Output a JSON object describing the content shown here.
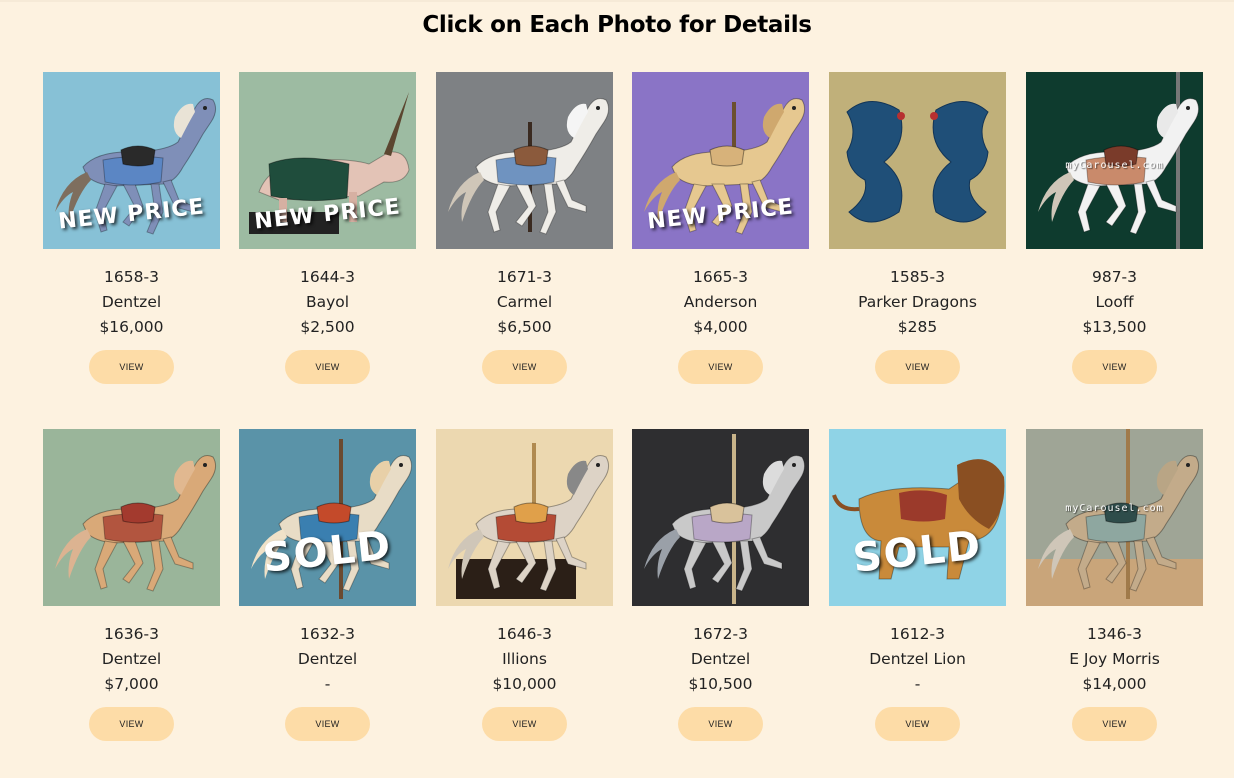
{
  "page": {
    "heading": "Click on Each Photo for Details"
  },
  "colors": {
    "background": "#fdf2e0",
    "button": "#fddca7"
  },
  "watermark_text": "myCarousel.com",
  "rows": [
    [
      {
        "id": "1658-3",
        "maker": "Dentzel",
        "price": "$16,000",
        "badge": "NEW PRICE",
        "button": "VIEW",
        "bg": "#87c1d6",
        "figure": "horse-blue"
      },
      {
        "id": "1644-3",
        "maker": "Bayol",
        "price": "$2,500",
        "badge": "NEW PRICE",
        "button": "VIEW",
        "bg": "#9dbba2",
        "figure": "unicorn"
      },
      {
        "id": "1671-3",
        "maker": "Carmel",
        "price": "$6,500",
        "badge": "",
        "button": "VIEW",
        "bg": "#7e8184",
        "figure": "horse-white"
      },
      {
        "id": "1665-3",
        "maker": "Anderson",
        "price": "$4,000",
        "badge": "NEW PRICE",
        "button": "VIEW",
        "bg": "#8a74c6",
        "figure": "horse-tan"
      },
      {
        "id": "1585-3",
        "maker": "Parker Dragons",
        "price": "$285",
        "badge": "",
        "button": "VIEW",
        "bg": "#c0b07a",
        "figure": "dragons"
      },
      {
        "id": "987-3",
        "maker": "Looff",
        "price": "$13,500",
        "badge": "",
        "button": "VIEW",
        "bg": "#0e3b2e",
        "figure": "horse-white-green",
        "watermark": true
      }
    ],
    [
      {
        "id": "1636-3",
        "maker": "Dentzel",
        "price": "$7,000",
        "badge": "",
        "button": "VIEW",
        "bg": "#9ab59a",
        "figure": "horse-palomino"
      },
      {
        "id": "1632-3",
        "maker": "Dentzel",
        "price": "-",
        "badge": "SOLD",
        "button": "VIEW",
        "bg": "#5a93a8",
        "figure": "horse-pole"
      },
      {
        "id": "1646-3",
        "maker": "Illions",
        "price": "$10,000",
        "badge": "",
        "button": "VIEW",
        "bg": "#ecd8b0",
        "figure": "horse-stand"
      },
      {
        "id": "1672-3",
        "maker": "Dentzel",
        "price": "$10,500",
        "badge": "",
        "button": "VIEW",
        "bg": "#2e2e30",
        "figure": "horse-grey"
      },
      {
        "id": "1612-3",
        "maker": "Dentzel Lion",
        "price": "-",
        "badge": "SOLD",
        "button": "VIEW",
        "bg": "#8fd3e6",
        "figure": "lion"
      },
      {
        "id": "1346-3",
        "maker": "E Joy Morris",
        "price": "$14,000",
        "badge": "",
        "button": "VIEW",
        "bg": "#9fa596",
        "figure": "horse-floor",
        "watermark": true
      }
    ]
  ]
}
